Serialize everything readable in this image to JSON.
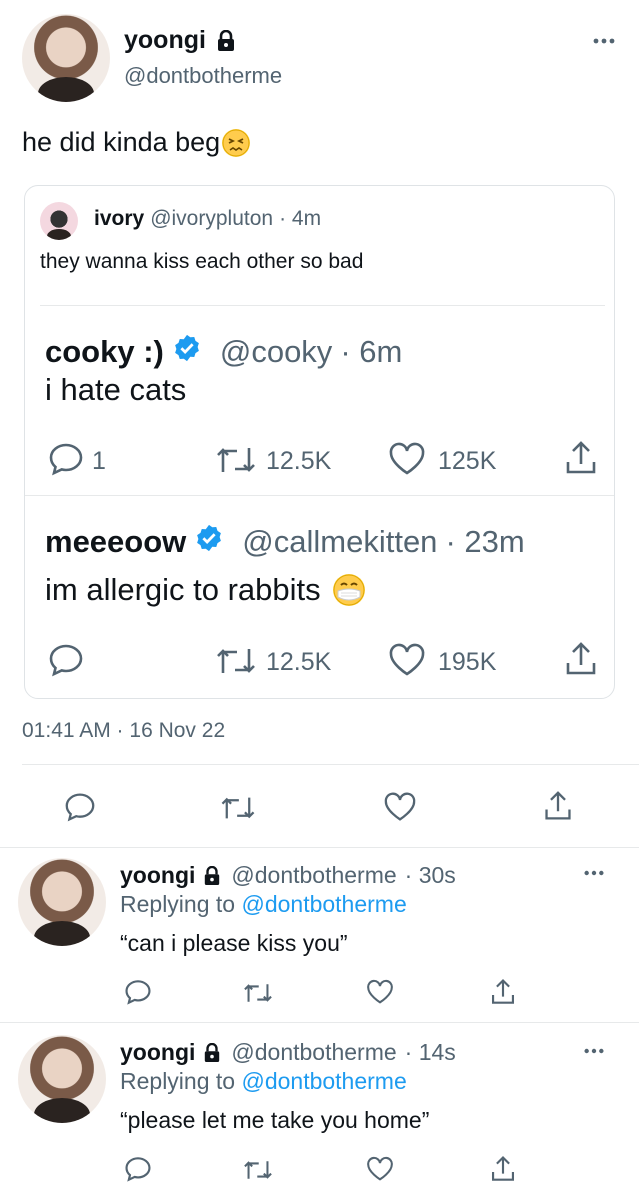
{
  "main_tweet": {
    "display_name": "yoongi",
    "handle": "@dontbotherme",
    "text": "he did kinda beg",
    "emoji": "confounded-face",
    "timestamp": "01:41 AM · 16 Nov 22"
  },
  "quote": {
    "display_name": "ivory",
    "handle": "@ivorypluton",
    "time": "· 4m",
    "text": "they wanna kiss each other so bad",
    "embedded": [
      {
        "display_name": "cooky :)",
        "handle": "@cooky",
        "time": "· 6m",
        "text": "i hate cats",
        "reply_count": "1",
        "retweet_count": "12.5K",
        "like_count": "125K"
      },
      {
        "display_name": "meeeoow",
        "handle": "@callmekitten",
        "time": "· 23m",
        "text": "im allergic to rabbits",
        "emoji": "face-with-medical-mask",
        "retweet_count": "12.5K",
        "like_count": "195K"
      }
    ]
  },
  "replies": [
    {
      "display_name": "yoongi",
      "handle": "@dontbotherme",
      "time": "· 30s",
      "replying_prefix": "Replying to",
      "replying_to": "@dontbotherme",
      "text": "“can i please kiss you”"
    },
    {
      "display_name": "yoongi",
      "handle": "@dontbotherme",
      "time": "· 14s",
      "replying_prefix": "Replying to",
      "replying_to": "@dontbotherme",
      "text": "“please let me take you home”"
    }
  ],
  "colors": {
    "accent": "#1d9bf0",
    "text": "#0f1419",
    "secondary": "#536471",
    "divider": "#e7e9ea"
  }
}
